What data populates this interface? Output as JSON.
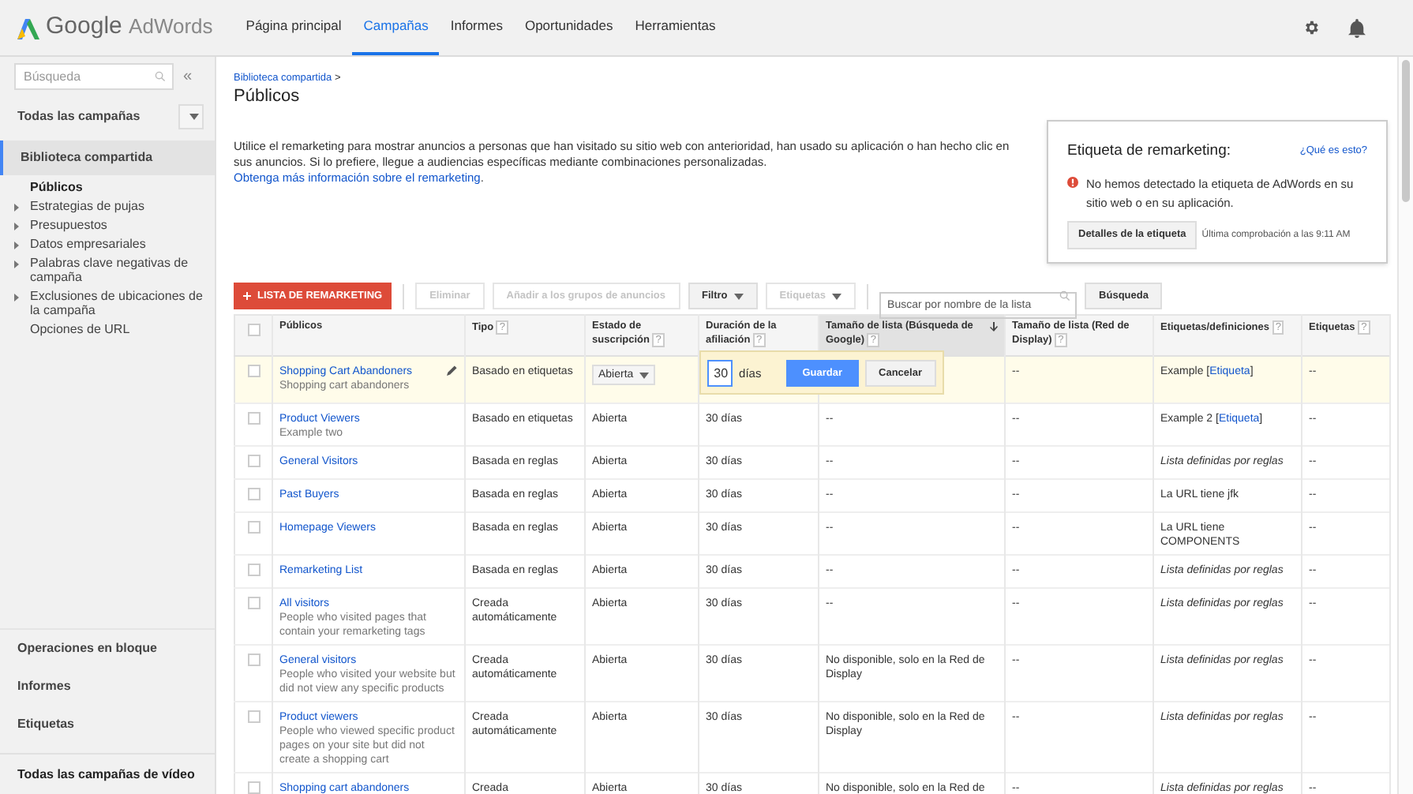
{
  "header": {
    "logo_google": "Google",
    "logo_product": "AdWords",
    "nav": [
      {
        "label": "Página principal",
        "selected": false
      },
      {
        "label": "Campañas",
        "selected": true
      },
      {
        "label": "Informes",
        "selected": false
      },
      {
        "label": "Oportunidades",
        "selected": false
      },
      {
        "label": "Herramientas",
        "selected": false
      }
    ]
  },
  "sidebar": {
    "search": {
      "placeholder": "Búsqueda"
    },
    "collapse": "«",
    "all_campaigns": "Todas las campañas",
    "section": {
      "label": "Biblioteca compartida",
      "selected": true
    },
    "items": [
      {
        "label": "Públicos",
        "expandable": false,
        "selected": true
      },
      {
        "label": "Estrategias de pujas",
        "expandable": true,
        "selected": false
      },
      {
        "label": "Presupuestos",
        "expandable": true,
        "selected": false
      },
      {
        "label": "Datos empresariales",
        "expandable": true,
        "selected": false
      },
      {
        "label": "Palabras clave negativas de campaña",
        "expandable": true,
        "selected": false
      },
      {
        "label": "Exclusiones de ubicaciones de la campaña",
        "expandable": true,
        "selected": false
      },
      {
        "label": "Opciones de URL",
        "expandable": false,
        "selected": false
      }
    ],
    "bottom": [
      "Operaciones en bloque",
      "Informes",
      "Etiquetas"
    ],
    "video": "Todas las campañas de vídeo"
  },
  "breadcrumb": "Biblioteca compartida",
  "breadcrumb_sep": ">",
  "page_title": "Públicos",
  "intro": {
    "text": "Utilice el remarketing para mostrar anuncios a personas que han visitado su sitio web con anterioridad, han usado su aplicación o han hecho clic en sus anuncios. Si lo prefiere, llegue a audiencias específicas mediante combinaciones personalizadas. ",
    "link": "Obtenga más información sobre el remarketing",
    "after": "."
  },
  "tag_box": {
    "title": "Etiqueta de remarketing:",
    "help_link": "¿Qué es esto?",
    "message": "No hemos detectado la etiqueta de AdWords en su sitio web o en su aplicación.",
    "button": "Detalles de la etiqueta",
    "last_check": "Última comprobación a las 9:11 AM"
  },
  "toolbar": {
    "add": "LISTA DE REMARKETING",
    "buttons": [
      {
        "label": "Eliminar",
        "disabled": true,
        "dropdown": false
      },
      {
        "label": "Añadir a los grupos de anuncios",
        "disabled": true,
        "dropdown": false
      },
      {
        "label": "Filtro",
        "disabled": false,
        "dropdown": true
      },
      {
        "label": "Etiquetas",
        "disabled": true,
        "dropdown": true
      }
    ],
    "search": {
      "placeholder": "Buscar por nombre de la lista"
    },
    "search_button": "Búsqueda"
  },
  "table": {
    "columns": [
      {
        "label": "Públicos",
        "sorted": false
      },
      {
        "label": "Tipo",
        "help": "?",
        "sorted": false
      },
      {
        "label": "Estado de suscripción",
        "help": "?",
        "sorted": false
      },
      {
        "label": "Duración de la afiliación",
        "help": "?",
        "sorted": false
      },
      {
        "label": "Tamaño de lista (Búsqueda de Google)",
        "help": "?",
        "sorted": true
      },
      {
        "label": "Tamaño de lista (Red de Display)",
        "help": "?",
        "sorted": false
      },
      {
        "label": "Etiquetas/definiciones",
        "help": "?",
        "sorted": false
      },
      {
        "label": "Etiquetas",
        "help": "?",
        "sorted": false
      }
    ],
    "select_all": {
      "checked": false
    },
    "editor": {
      "value": "30",
      "unit": "días",
      "save": "Guardar",
      "cancel": "Cancelar"
    },
    "rows": [
      {
        "checked": false,
        "editing": true,
        "name": "Shopping Cart Abandoners",
        "description": "Shopping cart abandoners",
        "type": "Basado en etiquetas",
        "status": "Abierta",
        "display_size": "--",
        "labels": {
          "kind": "link",
          "text": "Example [",
          "link": "Etiqueta",
          "after": "]"
        },
        "tags": "--"
      },
      {
        "checked": false,
        "editing": false,
        "name": "Product Viewers",
        "description": "Example two",
        "type": "Basado en etiquetas",
        "status": "Abierta",
        "duration": "30 días",
        "search_size": "--",
        "display_size": "--",
        "labels": {
          "kind": "link",
          "text": "Example 2 [",
          "link": "Etiqueta",
          "after": "]"
        },
        "tags": "--"
      },
      {
        "checked": false,
        "editing": false,
        "name": "General Visitors",
        "type": "Basada en reglas",
        "status": "Abierta",
        "duration": "30 días",
        "search_size": "--",
        "display_size": "--",
        "labels": {
          "kind": "rule",
          "text": "Lista definidas por reglas"
        },
        "tags": "--"
      },
      {
        "checked": false,
        "editing": false,
        "name": "Past Buyers",
        "type": "Basada en reglas",
        "status": "Abierta",
        "duration": "30 días",
        "search_size": "--",
        "display_size": "--",
        "labels": {
          "kind": "text",
          "text": "La URL tiene jfk"
        },
        "tags": "--"
      },
      {
        "checked": false,
        "editing": false,
        "name": "Homepage Viewers",
        "type": "Basada en reglas",
        "status": "Abierta",
        "duration": "30 días",
        "search_size": "--",
        "display_size": "--",
        "labels": {
          "kind": "text",
          "text": "La URL tiene COMPONENTS"
        },
        "tags": "--"
      },
      {
        "checked": false,
        "editing": false,
        "name": "Remarketing List",
        "type": "Basada en reglas",
        "status": "Abierta",
        "duration": "30 días",
        "search_size": "--",
        "display_size": "--",
        "labels": {
          "kind": "rule",
          "text": "Lista definidas por reglas"
        },
        "tags": "--"
      },
      {
        "checked": false,
        "editing": false,
        "name": "All visitors",
        "description": "People who visited pages that contain your remarketing tags",
        "type": "Creada automáticamente",
        "status": "Abierta",
        "duration": "30 días",
        "search_size": "--",
        "display_size": "--",
        "labels": {
          "kind": "rule",
          "text": "Lista definidas por reglas"
        },
        "tags": "--"
      },
      {
        "checked": false,
        "editing": false,
        "name": "General visitors",
        "description": "People who visited your website but did not view any specific products",
        "type": "Creada automáticamente",
        "status": "Abierta",
        "duration": "30 días",
        "search_size": "No disponible, solo en la Red de Display",
        "display_size": "--",
        "labels": {
          "kind": "rule",
          "text": "Lista definidas por reglas"
        },
        "tags": "--"
      },
      {
        "checked": false,
        "editing": false,
        "name": "Product viewers",
        "description": "People who viewed specific product pages on your site but did not create a shopping cart",
        "type": "Creada automáticamente",
        "status": "Abierta",
        "duration": "30 días",
        "search_size": "No disponible, solo en la Red de Display",
        "display_size": "--",
        "labels": {
          "kind": "rule",
          "text": "Lista definidas por reglas"
        },
        "tags": "--"
      },
      {
        "checked": false,
        "editing": false,
        "name": "Shopping cart abandoners",
        "type": "Creada",
        "status": "Abierta",
        "duration": "30 días",
        "search_size": "No disponible, solo en la Red de",
        "display_size": "--",
        "labels": {
          "kind": "rule",
          "text": "Lista definidas por reglas"
        },
        "tags": "--"
      }
    ]
  }
}
